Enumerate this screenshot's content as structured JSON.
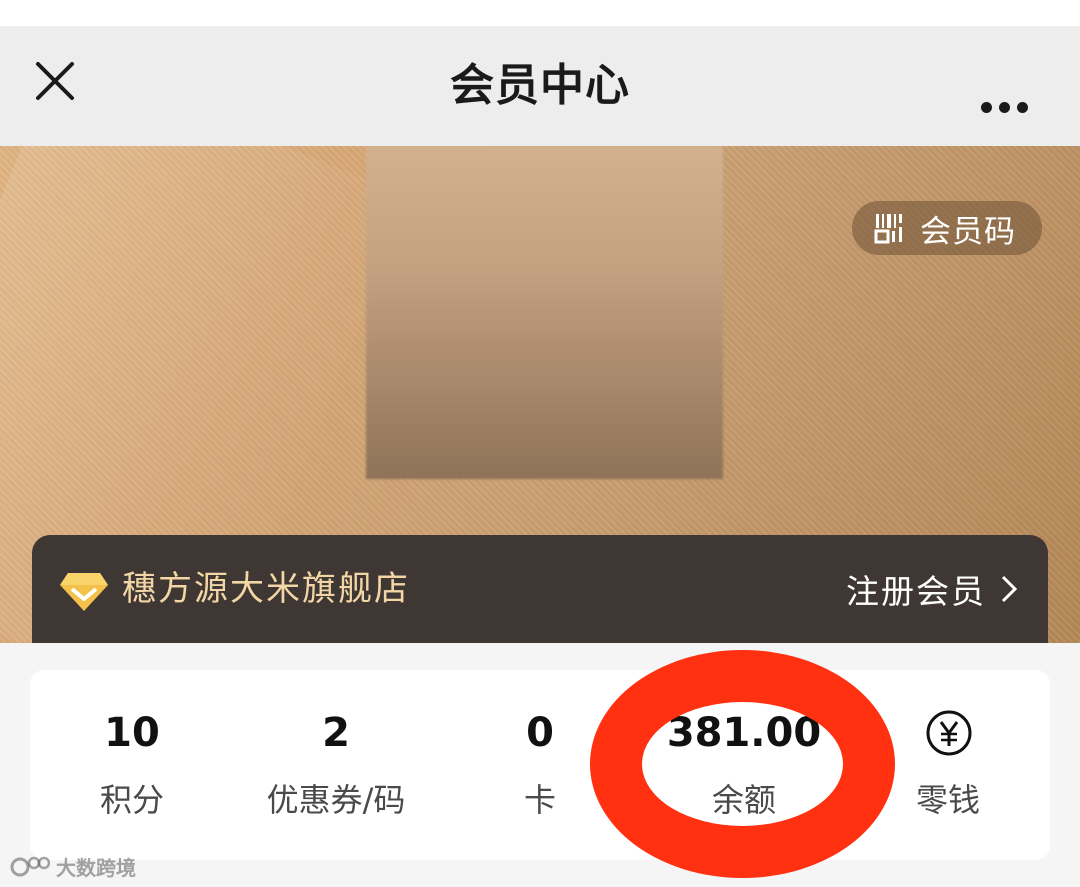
{
  "nav": {
    "title": "会员中心",
    "close_icon": "close-icon",
    "more_icon": "more-dots-icon"
  },
  "hero": {
    "member_code_label": "会员码",
    "member_code_icon": "barcode-icon"
  },
  "store": {
    "name": "穗方源大米旗舰店",
    "icon": "diamond-icon",
    "register_label": "注册会员",
    "register_icon": "chevron-right-icon"
  },
  "stats": [
    {
      "value": "10",
      "label": "积分"
    },
    {
      "value": "2",
      "label": "优惠券/码"
    },
    {
      "value": "0",
      "label": "卡"
    },
    {
      "value": "381.00",
      "label": "余额"
    },
    {
      "icon": "yen-icon",
      "label": "零钱"
    }
  ],
  "colors": {
    "highlight_ring": "#ff3111",
    "store_bar": "#3e3733",
    "store_name": "#f3d6a6"
  },
  "watermark": "大数跨境"
}
